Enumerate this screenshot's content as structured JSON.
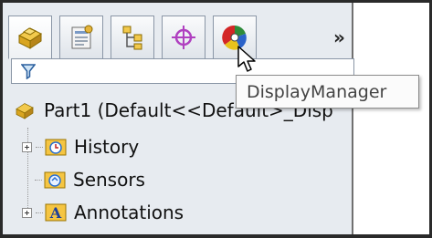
{
  "featuremanager": {
    "tabs": [
      {
        "name": "featuremanager-design-tree-tab",
        "icon": "part-icon"
      },
      {
        "name": "propertymanager-tab",
        "icon": "property-sheet-icon"
      },
      {
        "name": "configurationmanager-tab",
        "icon": "configuration-icon"
      },
      {
        "name": "dimxpertmanager-tab",
        "icon": "crosshair-target-icon"
      },
      {
        "name": "displaymanager-tab",
        "icon": "color-wheel-icon"
      }
    ],
    "more_tabs_label": "»",
    "tooltip": "DisplayManager",
    "tree": {
      "root_label": "Part1  (Default<<Default>_Disp",
      "items": [
        {
          "label": "History",
          "icon": "history-icon",
          "expandable": true
        },
        {
          "label": "Sensors",
          "icon": "sensors-icon",
          "expandable": false
        },
        {
          "label": "Annotations",
          "icon": "annotations-icon",
          "expandable": true
        }
      ]
    }
  },
  "colors": {
    "panel_background": "#e7ebf0",
    "tab_border": "#8a96a6",
    "frame": "#2a2a2a"
  }
}
